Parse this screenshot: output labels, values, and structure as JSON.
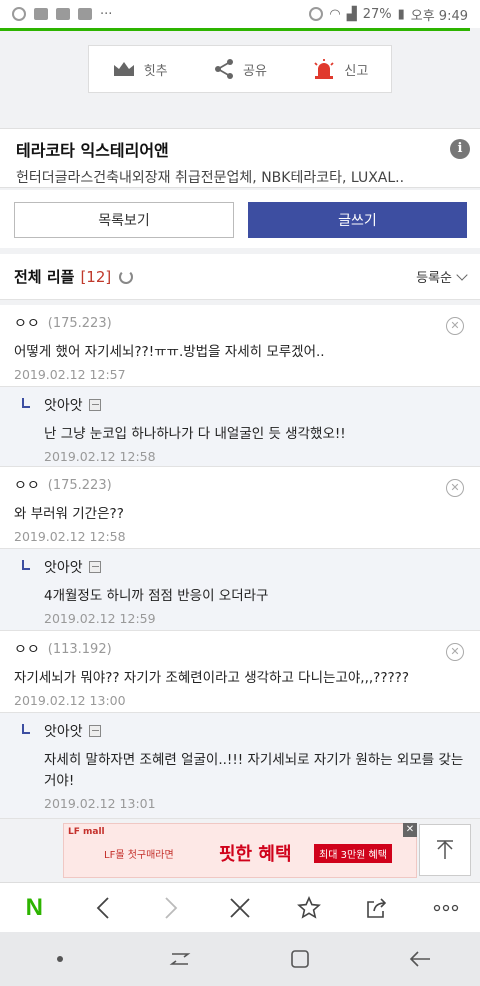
{
  "status_bar": {
    "battery": "27%",
    "time": "오후 9:49"
  },
  "actions": {
    "recommend_label": "힛추",
    "share_label": "공유",
    "report_label": "신고"
  },
  "ad": {
    "title": "테라코타 익스테리어앤",
    "description": "헌터더글라스건축내외장재 취급전문업체, NBK테라코타, LUXAL..",
    "info_icon": "i"
  },
  "buttons": {
    "list_label": "목록보기",
    "write_label": "글쓰기"
  },
  "replies": {
    "title": "전체 리플",
    "count": "[12]",
    "sort_label": "등록순"
  },
  "comments": [
    {
      "author": "ㅇㅇ",
      "ip": "(175.223)",
      "text": "어떻게 했어 자기세뇌??!ㅠㅠ.방법을 자세히 모루겠어..",
      "date": "2019.02.12 12:57",
      "is_reply": false
    },
    {
      "author": "앗아앗",
      "ip": "",
      "text": "난 그냥 눈코입 하나하나가 다 내얼굴인 듯 생각했오!!",
      "date": "2019.02.12 12:58",
      "is_reply": true
    },
    {
      "author": "ㅇㅇ",
      "ip": "(175.223)",
      "text": "와 부러워 기간은??",
      "date": "2019.02.12 12:58",
      "is_reply": false
    },
    {
      "author": "앗아앗",
      "ip": "",
      "text": "4개월정도 하니까 점점 반응이 오더라구",
      "date": "2019.02.12 12:59",
      "is_reply": true
    },
    {
      "author": "ㅇㅇ",
      "ip": "(113.192)",
      "text": "자기세뇌가 뭐야?? 자기가 조혜련이라고 생각하고 다니는고야,,,?????",
      "date": "2019.02.12 13:00",
      "is_reply": false
    },
    {
      "author": "앗아앗",
      "ip": "",
      "text": "자세히 말하자면 조혜련 얼굴이..!!! 자기세뇌로 자기가 원하는 외모를 갖는거야!",
      "date": "2019.02.12 13:01",
      "is_reply": true
    }
  ],
  "banner": {
    "brand": "LF mall",
    "tagline": "LF몰 첫구매라면",
    "headline": "핏한 혜택",
    "badge": "최대 3만원 혜택"
  },
  "colors": {
    "accent_green": "#2db400",
    "write_button": "#3d4ea1",
    "count_red": "#c0392b"
  }
}
